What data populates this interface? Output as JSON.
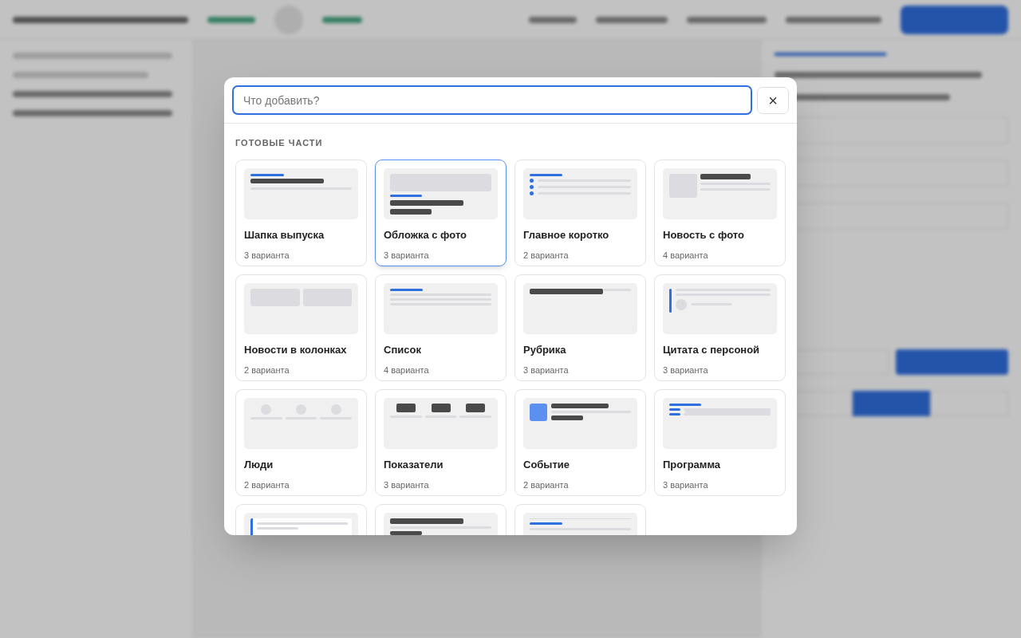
{
  "dialog": {
    "search": {
      "placeholder": "Что добавить?"
    },
    "close_button": {
      "label": "×"
    },
    "section_title": "ГОТОВЫЕ ЧАСТИ",
    "parts": [
      {
        "title": "Шапка выпуска",
        "variants": "3 варианта",
        "kind": "header",
        "selected": false
      },
      {
        "title": "Обложка с фото",
        "variants": "3 варианта",
        "kind": "cover",
        "selected": true
      },
      {
        "title": "Главное коротко",
        "variants": "2 варианта",
        "kind": "bullets",
        "selected": false
      },
      {
        "title": "Новость с фото",
        "variants": "4 варианта",
        "kind": "photo_news",
        "selected": false
      },
      {
        "title": "Новости в колонках",
        "variants": "2 варианта",
        "kind": "columns",
        "selected": false
      },
      {
        "title": "Список",
        "variants": "4 варианта",
        "kind": "list",
        "selected": false
      },
      {
        "title": "Рубрика",
        "variants": "3 варианта",
        "kind": "rubric",
        "selected": false
      },
      {
        "title": "Цитата с персоной",
        "variants": "3 варианта",
        "kind": "quote",
        "selected": false
      },
      {
        "title": "Люди",
        "variants": "2 варианта",
        "kind": "people",
        "selected": false
      },
      {
        "title": "Показатели",
        "variants": "3 варианта",
        "kind": "stats",
        "selected": false
      },
      {
        "title": "Событие",
        "variants": "2 варианта",
        "kind": "event",
        "selected": false
      },
      {
        "title": "Программа",
        "variants": "3 варианта",
        "kind": "program",
        "selected": false
      },
      {
        "kind": "quote_box",
        "selected": false
      },
      {
        "kind": "headline",
        "selected": false
      },
      {
        "kind": "divider_list",
        "selected": false
      }
    ]
  }
}
